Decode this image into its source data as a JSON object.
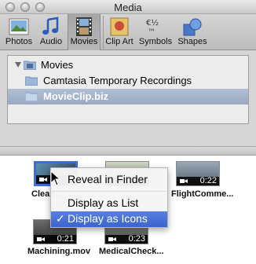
{
  "window": {
    "title": "Media"
  },
  "toolbar": {
    "items": [
      {
        "label": "Photos",
        "icon": "photos-icon"
      },
      {
        "label": "Audio",
        "icon": "audio-icon"
      },
      {
        "label": "Movies",
        "icon": "movies-icon",
        "selected": true
      },
      {
        "label": "Clip Art",
        "icon": "clipart-icon"
      },
      {
        "label": "Symbols",
        "icon": "symbols-icon"
      },
      {
        "label": "Shapes",
        "icon": "shapes-icon"
      }
    ]
  },
  "source_list": {
    "root": "Movies",
    "children": [
      "Camtasia Temporary Recordings",
      "MovieClip.biz"
    ],
    "selected": "MovieClip.biz"
  },
  "thumbnails": [
    {
      "name": "Clean...",
      "duration": ""
    },
    {
      "name": "",
      "duration": ""
    },
    {
      "name": "FlightComme...",
      "duration": "0:22"
    },
    {
      "name": "Machining.mov",
      "duration": "0:21"
    },
    {
      "name": "MedicalCheck...",
      "duration": "0:23"
    }
  ],
  "context_menu": {
    "items": [
      "Reveal in Finder",
      "Display as List",
      "Display as Icons"
    ],
    "checked": "Display as Icons",
    "check_glyph": "✓"
  },
  "colors": {
    "selection": "#3b6fd0",
    "menu_highlight": "#3a64cf",
    "source_selection": "#a3b2c9"
  }
}
